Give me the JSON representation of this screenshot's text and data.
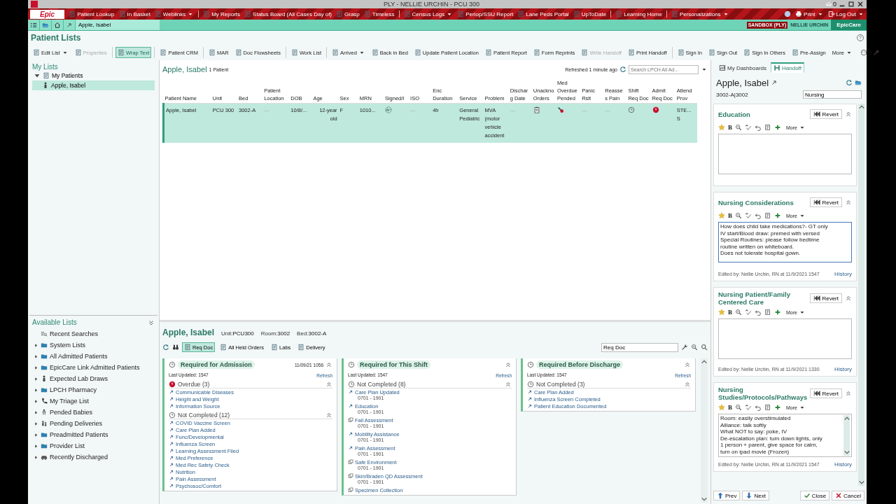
{
  "window": {
    "title": "PLY - NELLIE URCHIN - PCU 300",
    "mail_count": "0"
  },
  "menu_bar": {
    "logo": "Epic",
    "groups": [
      {
        "items": [
          {
            "label": "Patient Lookup",
            "dropdown": false
          },
          {
            "label": "In Basket",
            "dropdown": false
          },
          {
            "label": "Weblinks",
            "dropdown": true
          }
        ]
      },
      {
        "items": [
          {
            "label": "My Reports",
            "dropdown": false
          },
          {
            "label": "Status Board (All Cases Day of)",
            "dropdown": false
          },
          {
            "label": "Grasp",
            "dropdown": false
          },
          {
            "label": "Timeless",
            "dropdown": false
          }
        ]
      },
      {
        "items": [
          {
            "label": "Census Logs",
            "dropdown": true
          },
          {
            "label": "Periop/SSU Report",
            "dropdown": false
          },
          {
            "label": "Lane Peds Portal",
            "dropdown": false
          },
          {
            "label": "UpToDate",
            "dropdown": false
          }
        ]
      },
      {
        "items": [
          {
            "label": "Learning Home",
            "dropdown": false
          }
        ]
      },
      {
        "items": [
          {
            "label": "Personalizations",
            "dropdown": true
          }
        ]
      }
    ],
    "right_items": [
      {
        "label": "Print",
        "dropdown": true
      },
      {
        "label": "Log Out",
        "dropdown": true
      }
    ]
  },
  "nav_bar": {
    "patient_tab": "Apple, Isabel",
    "environment": "SANDBOX (PLY)",
    "user": "NELLIE URCHIN",
    "app": "EpicCare"
  },
  "activity": {
    "title": "Patient Lists",
    "help_label": "?"
  },
  "toolbar": {
    "groups": [
      {
        "items": [
          {
            "label": "Edit List",
            "dropdown": true,
            "disabled": false,
            "selected": false
          },
          {
            "label": "Properties",
            "dropdown": false,
            "disabled": true,
            "selected": false
          }
        ]
      },
      {
        "items": [
          {
            "label": "Wrap Text",
            "dropdown": false,
            "disabled": false,
            "selected": true
          }
        ]
      },
      {
        "items": [
          {
            "label": "Patient CRM",
            "dropdown": false,
            "disabled": false,
            "selected": false
          }
        ]
      },
      {
        "items": [
          {
            "label": "MAR",
            "dropdown": false,
            "disabled": false,
            "selected": false
          },
          {
            "label": "Doc Flowsheets",
            "dropdown": false,
            "disabled": false,
            "selected": false
          }
        ]
      },
      {
        "items": [
          {
            "label": "Work List",
            "dropdown": false,
            "disabled": false,
            "selected": false
          }
        ]
      },
      {
        "items": [
          {
            "label": "Arrived",
            "dropdown": true,
            "disabled": false,
            "selected": false
          },
          {
            "label": "Back in Bed",
            "dropdown": false,
            "disabled": false,
            "selected": false
          },
          {
            "label": "Update Patient Location",
            "dropdown": false,
            "disabled": false,
            "selected": false
          },
          {
            "label": "Patient Report",
            "dropdown": false,
            "disabled": false,
            "selected": false
          },
          {
            "label": "Form Reprints",
            "dropdown": false,
            "disabled": false,
            "selected": false
          },
          {
            "label": "Write Handoff",
            "dropdown": false,
            "disabled": true,
            "selected": false
          },
          {
            "label": "Print Handoff",
            "dropdown": false,
            "disabled": false,
            "selected": false
          }
        ]
      },
      {
        "items": [
          {
            "label": "Sign In",
            "dropdown": false,
            "disabled": false,
            "selected": false
          },
          {
            "label": "Sign Out",
            "dropdown": false,
            "disabled": false,
            "selected": false
          },
          {
            "label": "Sign In Others",
            "dropdown": false,
            "disabled": false,
            "selected": false
          },
          {
            "label": "Pre-Assign",
            "dropdown": false,
            "disabled": false,
            "selected": false
          },
          {
            "label": "More",
            "dropdown": true,
            "disabled": false,
            "selected": false
          }
        ]
      }
    ]
  },
  "my_lists": {
    "title": "My Lists",
    "tree": [
      {
        "label": "My Patients",
        "expanded": true,
        "selected": false,
        "children": [
          {
            "label": "Apple, Isabel",
            "selected": true
          }
        ]
      }
    ]
  },
  "available_lists": {
    "title": "Available Lists",
    "items": [
      {
        "label": "Recent Searches",
        "kind": "search",
        "expandable": false
      },
      {
        "label": "System Lists",
        "kind": "folder",
        "expandable": true
      },
      {
        "label": "All Admitted Patients",
        "kind": "folder",
        "expandable": true
      },
      {
        "label": "EpicCare Link Admitted Patients",
        "kind": "folder",
        "expandable": true
      },
      {
        "label": "Expected Lab Draws",
        "kind": "person",
        "expandable": true
      },
      {
        "label": "LPCH Pharmacy",
        "kind": "folder",
        "expandable": true
      },
      {
        "label": "My Triage List",
        "kind": "phone",
        "expandable": true
      },
      {
        "label": "Pended Babies",
        "kind": "baby",
        "expandable": true
      },
      {
        "label": "Pending Deliveries",
        "kind": "people",
        "expandable": true
      },
      {
        "label": "Preadmitted Patients",
        "kind": "folder",
        "expandable": true
      },
      {
        "label": "Provider List",
        "kind": "folder",
        "expandable": true
      },
      {
        "label": "Recently Discharged",
        "kind": "car",
        "expandable": true
      }
    ]
  },
  "patient_list": {
    "title": "Apple, Isabel",
    "count": "1 Patient",
    "refreshed": "Refreshed 1 minute ago",
    "search_placeholder": "Search LPCH All Ad...",
    "columns": [
      "Patient Name",
      "Unit",
      "Bed",
      "Patient Location",
      "DOB",
      "Age",
      "Sex",
      "MRN",
      "Signed/I",
      "ISO",
      "Enc Duration",
      "Service",
      "Problem",
      "Discharg Date",
      "Unackno Orders",
      "Med Overdue Pended",
      "Panic Rslt",
      "Reasses Pain",
      "Shift Req Doc",
      "Admit Req Doc",
      "Attend Prov"
    ],
    "rows": [
      {
        "selected": true,
        "cells": [
          {
            "kind": "text",
            "text": "Apple, Isabel"
          },
          {
            "kind": "text",
            "text": "PCU 300"
          },
          {
            "kind": "text",
            "text": "3002-A"
          },
          {
            "kind": "dash",
            "text": "—"
          },
          {
            "kind": "text",
            "text": "10/8/..."
          },
          {
            "kind": "number",
            "text": "12-year old"
          },
          {
            "kind": "text",
            "text": "F"
          },
          {
            "kind": "text",
            "text": "1010..."
          },
          {
            "kind": "signature"
          },
          {
            "kind": "dash",
            "text": "—"
          },
          {
            "kind": "text",
            "text": "4h"
          },
          {
            "kind": "text",
            "text": "General Pediatric"
          },
          {
            "kind": "text",
            "text": "MVA (motor vehicle accident"
          },
          {
            "kind": "dash",
            "text": "—"
          },
          {
            "kind": "clipboard"
          },
          {
            "kind": "medication"
          },
          {
            "kind": "dash",
            "text": "—"
          },
          {
            "kind": "dash",
            "text": "—"
          },
          {
            "kind": "clock"
          },
          {
            "kind": "alert"
          },
          {
            "kind": "text",
            "text": "STE... S"
          }
        ]
      }
    ]
  },
  "patient_header": {
    "name": "Apple, Isabel",
    "fields": [
      {
        "label": "Unit:",
        "value": "PCU300"
      },
      {
        "label": "Room:",
        "value": "3002"
      },
      {
        "label": "Bed:",
        "value": "3002-A"
      }
    ]
  },
  "report_toolbar": {
    "tabs": [
      {
        "label": "Req Doc",
        "selected": true
      },
      {
        "label": "All Held Orders",
        "selected": false
      },
      {
        "label": "Labs",
        "selected": false
      },
      {
        "label": "Delivery",
        "selected": false
      }
    ],
    "search_value": "Req Doc"
  },
  "req_doc_cards": [
    {
      "title": "Required for Admission",
      "date": "11/09/21 1056",
      "last_updated": "Last Updated: 1547",
      "refresh": "Refresh",
      "groups": [
        {
          "title": "Overdue (3)",
          "kind": "overdue",
          "items": [
            {
              "label": "Communicable Diseases",
              "kind": "link"
            },
            {
              "label": "Height and Weight",
              "kind": "link"
            },
            {
              "label": "Information Source",
              "kind": "link"
            }
          ]
        },
        {
          "title": "Not Completed (12)",
          "kind": "pending",
          "items": [
            {
              "label": "COVID Vaccine Screen",
              "kind": "link"
            },
            {
              "label": "Care Plan Added",
              "kind": "link"
            },
            {
              "label": "Func/Developmental",
              "kind": "link"
            },
            {
              "label": "Influenza Screen",
              "kind": "link"
            },
            {
              "label": "Learning Assessment Filed",
              "kind": "link"
            },
            {
              "label": "Med Preference",
              "kind": "link"
            },
            {
              "label": "Med Rec Safety Check",
              "kind": "link"
            },
            {
              "label": "Nutrition",
              "kind": "link"
            },
            {
              "label": "Pain Assessment",
              "kind": "link"
            },
            {
              "label": "Psychosoc/Comfort",
              "kind": "link"
            }
          ]
        }
      ]
    },
    {
      "title": "Required for This Shift",
      "last_updated": "Last Updated: 1547",
      "refresh": "Refresh",
      "groups": [
        {
          "title": "Not Completed (8)",
          "kind": "pending",
          "items": [
            {
              "label": "Care Plan Updated",
              "time": "0701 - 1901",
              "kind": "link"
            },
            {
              "label": "Education",
              "time": "0701 - 1901",
              "kind": "link"
            },
            {
              "label": "Fall Assessment",
              "time": "0701 - 1901",
              "kind": "task"
            },
            {
              "label": "Mobility Assistance",
              "time": "0701 - 1901",
              "kind": "link"
            },
            {
              "label": "Pain Assessment",
              "time": "0701 - 1901",
              "kind": "link"
            },
            {
              "label": "Safe Environment",
              "time": "0701 - 1901",
              "kind": "task"
            },
            {
              "label": "Skin/Braden QD Assessment",
              "time": "0701 - 1901",
              "kind": "task"
            },
            {
              "label": "Specimen Collection",
              "kind": "task"
            }
          ]
        }
      ]
    },
    {
      "title": "Required Before Discharge",
      "last_updated": "Last Updated: 1547",
      "refresh": "Refresh",
      "groups": [
        {
          "title": "Not Completed (3)",
          "kind": "pending",
          "items": [
            {
              "label": "Care Plan Added",
              "kind": "link"
            },
            {
              "label": "Influenza Screen Completed",
              "kind": "link"
            },
            {
              "label": "Patient Education Documented",
              "kind": "link"
            }
          ]
        }
      ]
    }
  ],
  "handoff": {
    "tabs": [
      {
        "label": "My Dashboards",
        "selected": false
      },
      {
        "label": "Handoff",
        "selected": true
      }
    ],
    "patient_name": "Apple, Isabel",
    "location": "3002-A|3002",
    "search_value": "Nursing",
    "sections": [
      {
        "title": "Education",
        "revert": "Revert",
        "bold_label": "B",
        "more_label": "More",
        "focused": false
      },
      {
        "title": "Nursing Considerations",
        "revert": "Revert",
        "bold_label": "B",
        "more_label": "More",
        "focused": true,
        "lines": [
          "How does child take medications?- GT only",
          "IV start/Blood draw: premed with versed",
          "Special Routines: please follow bedtime",
          "routine written on whiteboard.",
          "Does not tolerate hospital gown."
        ],
        "edited": "Edited by: Nellie Urchin, RN at 11/9/2021 1547",
        "history": "History"
      },
      {
        "title": "Nursing Patient/Family Centered Care",
        "revert": "Revert",
        "bold_label": "B",
        "more_label": "More",
        "focused": false,
        "edited": "Edited by: Nellie Urchin, RN at 11/9/2021 1330",
        "history": "History"
      },
      {
        "title": "Nursing Studies/Protocols/Pathways",
        "revert": "Revert",
        "bold_label": "B",
        "more_label": "More",
        "focused": false,
        "lines": [
          "Room: easily overstimulated",
          "Alliance: talk softly",
          "What NOT to say: poke, IV",
          "De-escalation plan: turn down lights, only",
          "1 person + parent, give space for calm,",
          "turn on ipad movie (Frozen)"
        ],
        "edited": "Edited by: Nellie Urchin, RN at 11/9/2021 1547",
        "history": "History"
      }
    ],
    "footer_buttons": [
      {
        "label": "Prev",
        "kind": "prev"
      },
      {
        "label": "Next",
        "kind": "next"
      },
      {
        "label": "Close",
        "kind": "close"
      },
      {
        "label": "Cancel",
        "kind": "cancel"
      }
    ]
  }
}
